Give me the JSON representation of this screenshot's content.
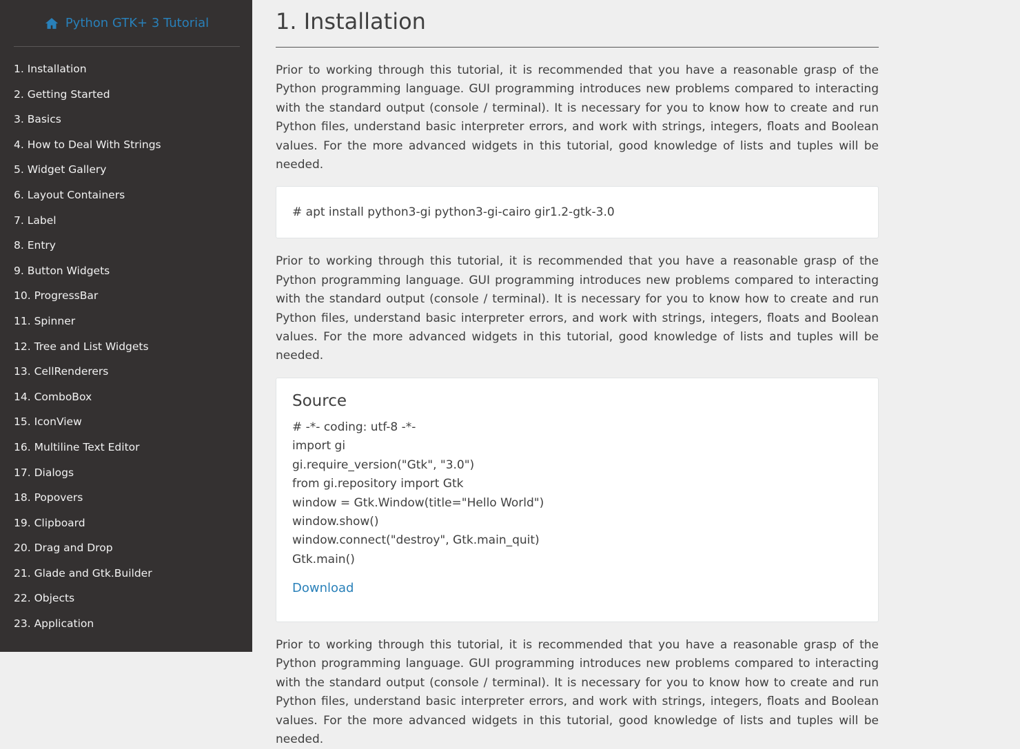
{
  "sidebar": {
    "brand_title": "Python GTK+ 3 Tutorial",
    "brand_icon": "home-icon",
    "items": [
      "1. Installation",
      "2. Getting Started",
      "3. Basics",
      "4. How to Deal With Strings",
      "5. Widget Gallery",
      "6. Layout Containers",
      "7. Label",
      "8. Entry",
      "9. Button Widgets",
      "10. ProgressBar",
      "11. Spinner",
      "12. Tree and List Widgets",
      "13. CellRenderers",
      "14. ComboBox",
      "15. IconView",
      "16. Multiline Text Editor",
      "17. Dialogs",
      "18. Popovers",
      "19. Clipboard",
      "20. Drag and Drop",
      "21. Glade and Gtk.Builder",
      "22. Objects",
      "23. Application"
    ]
  },
  "main": {
    "title": "1. Installation",
    "paragraph": "Prior to working through this tutorial, it is recommended that you have a reasonable grasp of the Python programming language. GUI programming introduces new problems compared to interacting with the standard output (console / terminal). It is necessary for you to know how to create and run Python files, understand basic interpreter errors, and work with strings, integers, floats and Boolean values. For the more advanced widgets in this tutorial, good knowledge of lists and tuples will be needed.",
    "command": "# apt install python3-gi python3-gi-cairo gir1.2-gtk-3.0",
    "source": {
      "heading": "Source",
      "lines": [
        "# -*- coding: utf-8 -*-",
        "import gi",
        "gi.require_version(\"Gtk\", \"3.0\")",
        "from gi.repository import Gtk",
        "window = Gtk.Window(title=\"Hello World\")",
        "window.show()",
        "window.connect(\"destroy\", Gtk.main_quit)",
        "Gtk.main()"
      ],
      "download_label": "Download"
    }
  },
  "colors": {
    "sidebar_bg": "#343131",
    "link": "#2980b9",
    "page_bg": "#efefef",
    "text": "#404040"
  }
}
